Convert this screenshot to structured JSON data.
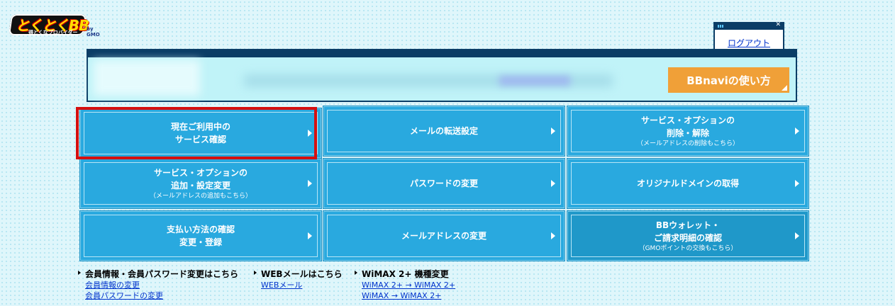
{
  "logo": {
    "main": "とくとくBB",
    "sub": "得とくなプロバイダー",
    "gmo": "by GMO"
  },
  "logout": {
    "label": "ログアウト"
  },
  "guide_button": {
    "label": "BBnaviの使い方"
  },
  "tiles": [
    {
      "label": "現在ご利用中の\nサービス確認",
      "note": ""
    },
    {
      "label": "メールの転送設定",
      "note": ""
    },
    {
      "label": "サービス・オプションの\n削除・解除",
      "note": "（メールアドレスの削除もこちら）"
    },
    {
      "label": "サービス・オプションの\n追加・設定変更",
      "note": "（メールアドレスの追加もこちら）"
    },
    {
      "label": "パスワードの変更",
      "note": ""
    },
    {
      "label": "オリジナルドメインの取得",
      "note": ""
    },
    {
      "label": "支払い方法の確認\n変更・登録",
      "note": ""
    },
    {
      "label": "メールアドレスの変更",
      "note": ""
    },
    {
      "label": "BBウォレット・\nご請求明細の確認",
      "note": "（GMOポイントの交換もこちら）"
    }
  ],
  "links": {
    "member": {
      "title": "会員情報・会員パスワード変更はこちら",
      "items": [
        "会員情報の変更",
        "会員パスワードの変更"
      ]
    },
    "webmail": {
      "title": "WEBメールはこちら",
      "items": [
        "WEBメール"
      ]
    },
    "wimax": {
      "title": "WiMAX 2+ 機種変更",
      "items": [
        "WiMAX 2+ → WiMAX 2+",
        "WiMAX → WiMAX 2+"
      ]
    }
  }
}
